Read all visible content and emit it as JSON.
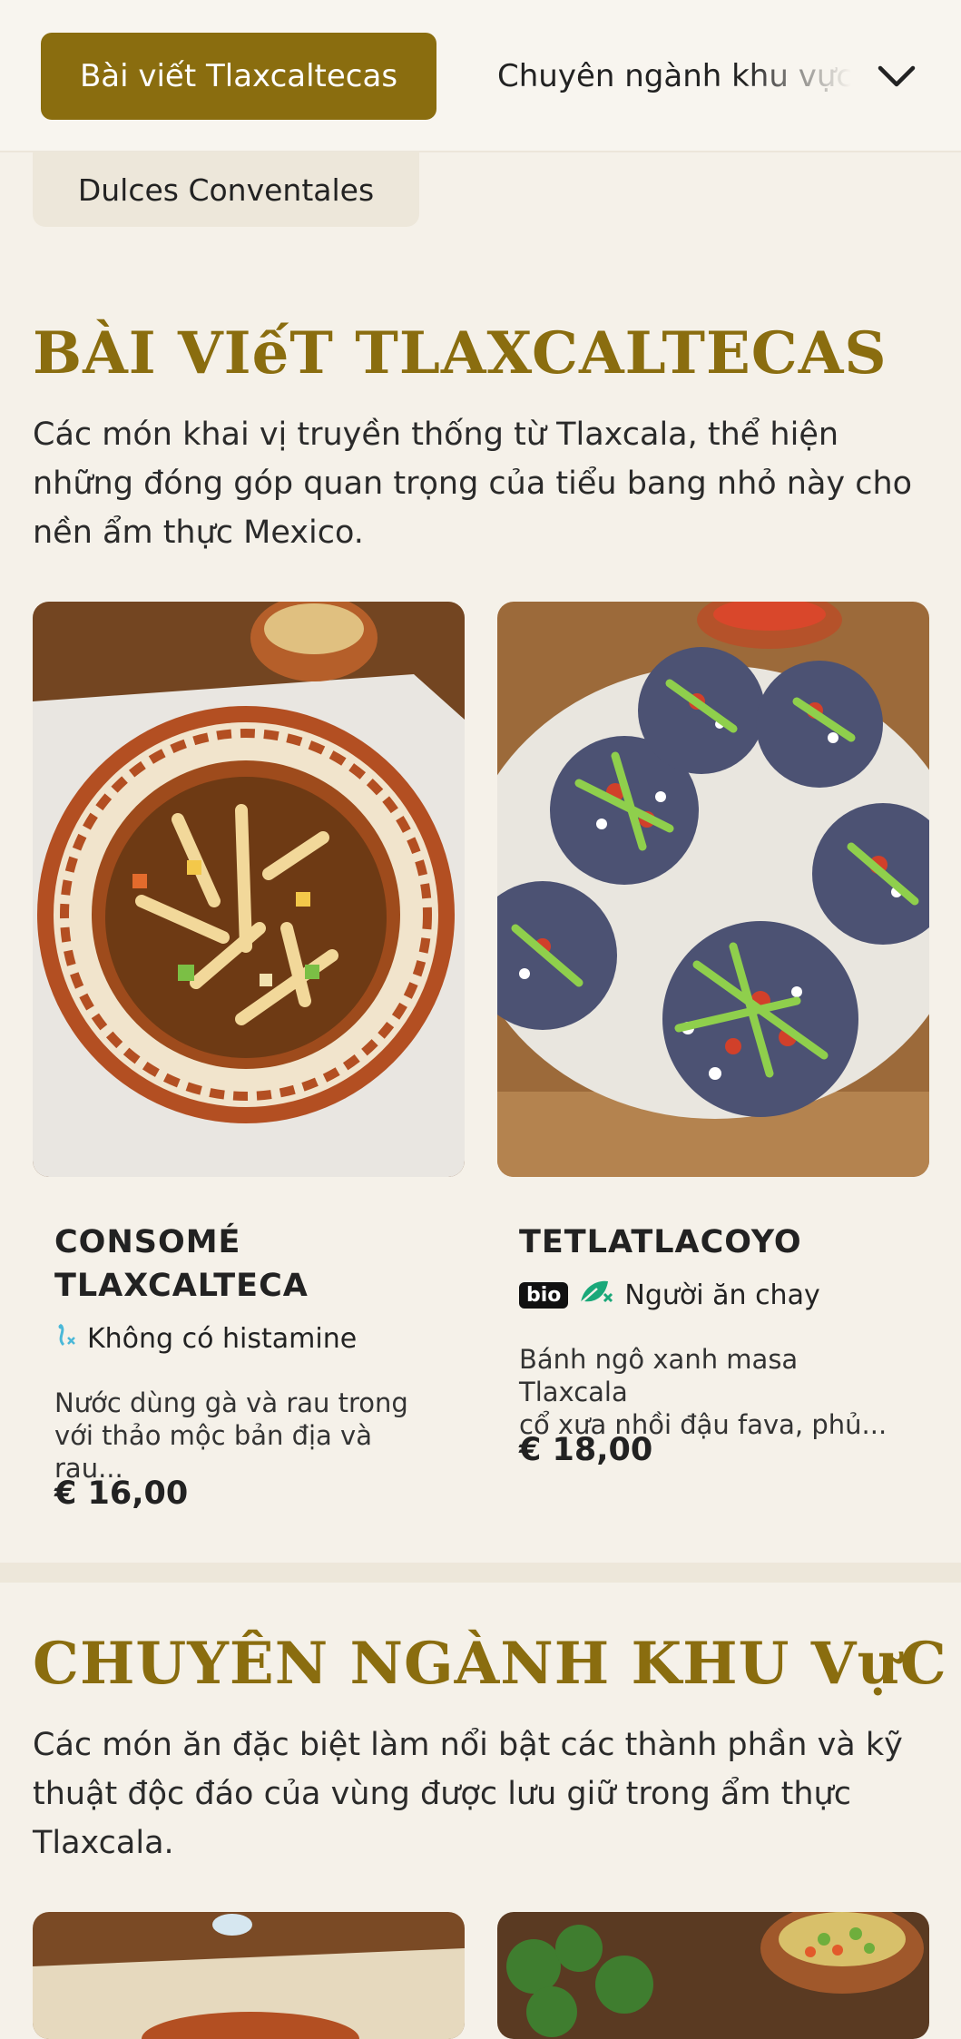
{
  "nav": {
    "active_category": "Bài viết Tlaxcaltecas",
    "next_category": "Chuyên ngành khu vực",
    "prev_chip": "Dulces Conventales"
  },
  "section1": {
    "title": "BÀI VIếT TLAXCALTECAS",
    "description": "Các món khai vị truyền thống từ Tlaxcala, thể hiện những đóng góp quan trọng của tiểu bang nhỏ này cho nền ẩm thực Mexico.",
    "items": [
      {
        "title_line1": "CONSOMÉ",
        "title_line2": "TLAXCALTECA",
        "tag": "Không có histamine",
        "tag_icon": "histamine-free-icon",
        "desc_line1": "Nước dùng gà và rau trong",
        "desc_line2": "với thảo mộc bản địa và rau...",
        "price": "€ 16,00"
      },
      {
        "title": "TETLATLACOYO",
        "badge": "bio",
        "tag": "Người ăn chay",
        "tag_icon": "vegetarian-icon",
        "desc_line1": "Bánh ngô xanh masa Tlaxcala",
        "desc_line2": "cổ xưa nhồi đậu fava, phủ...",
        "price": "€ 18,00"
      }
    ]
  },
  "section2": {
    "title": "CHUYÊN NGÀNH KHU VựC",
    "description": "Các món ăn đặc biệt làm nổi bật các thành phần và kỹ thuật độc đáo của vùng được lưu giữ trong ẩm thực Tlaxcala."
  },
  "colors": {
    "accent": "#8a6d0f",
    "background": "#f5f1e9",
    "vegetarian_icon": "#1aa879",
    "histamine_icon": "#4ab8d8"
  }
}
